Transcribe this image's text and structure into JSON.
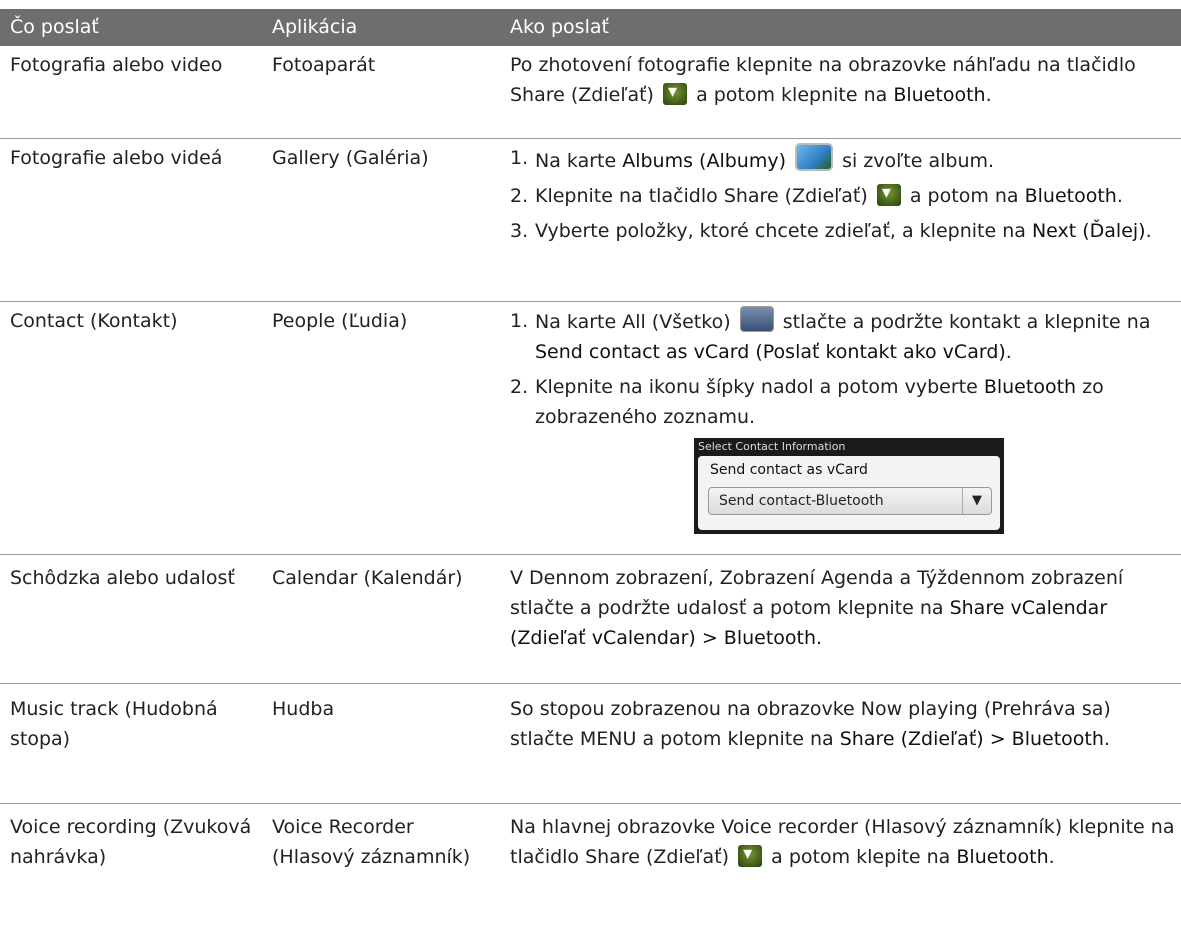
{
  "header": {
    "col1": "Čo poslať",
    "col2": "Aplikácia",
    "col3": "Ako poslať"
  },
  "rows": [
    {
      "what": "Fotografia alebo video",
      "app": "Fotoaparát",
      "how": {
        "t1": "Po zhotovení fotografie klepnite na obrazovke náhľadu na tlačidlo Share (Zdieľať)",
        "t2": "a potom klepnite na",
        "b1": "Bluetooth",
        "t3": "."
      }
    },
    {
      "what": "Fotografie alebo videá",
      "app": "Gallery (Galéria)",
      "steps": [
        {
          "num": "1.",
          "t1": "Na karte",
          "b1": "Albums (Albumy)",
          "t2": "si zvoľte album."
        },
        {
          "num": "2.",
          "t1": "Klepnite na tlačidlo Share (Zdieľať)",
          "t2": "a potom na",
          "b1": "Bluetooth",
          "t3": "."
        },
        {
          "num": "3.",
          "t1": "Vyberte položky, ktoré chcete zdieľať, a klepnite na",
          "b1": "Next (Ďalej)",
          "t2": "."
        }
      ]
    },
    {
      "what": "Contact (Kontakt)",
      "app": "People (Ľudia)",
      "steps": [
        {
          "num": "1.",
          "t1": "Na karte All (Všetko)",
          "t2": "stlačte a podržte kontakt a klepnite na",
          "b1": "Send contact as vCard (Poslať kontakt ako vCard)",
          "t3": "."
        },
        {
          "num": "2.",
          "t1": "Klepnite na ikonu šípky nadol a potom vyberte",
          "b1": "Bluetooth",
          "t2": "zo zobrazeného zoznamu."
        }
      ],
      "screenshot": {
        "title": "Select Contact Information",
        "label": "Send contact as vCard",
        "selected": "Send contact-Bluetooth"
      }
    },
    {
      "what": "Schôdzka alebo udalosť",
      "app": "Calendar (Kalendár)",
      "how": {
        "t1": "V Dennom zobrazení, Zobrazení Agenda a Týždennom zobrazení stlačte a podržte udalosť a potom klepnite na",
        "b1": "Share vCalendar (Zdieľať vCalendar) > Bluetooth",
        "t2": "."
      }
    },
    {
      "what": "Music track (Hudobná stopa)",
      "app": "Hudba",
      "how": {
        "t1": "So stopou zobrazenou na obrazovke Now playing (Prehráva sa) stlačte MENU a potom klepnite na",
        "b1": "Share (Zdieľať) > Bluetooth",
        "t2": "."
      }
    },
    {
      "what": "Voice recording (Zvuková nahrávka)",
      "app": "Voice Recorder (Hlasový záznamník)",
      "how": {
        "t1": "Na hlavnej obrazovke Voice recorder (Hlasový záznamník) klepnite na tlačidlo Share (Zdieľať)",
        "t2": "a potom klepite na",
        "b1": "Bluetooth",
        "t3": "."
      }
    }
  ],
  "icons": {
    "share": "share-icon",
    "albums": "albums-tab-icon",
    "all": "all-contacts-tab-icon"
  }
}
